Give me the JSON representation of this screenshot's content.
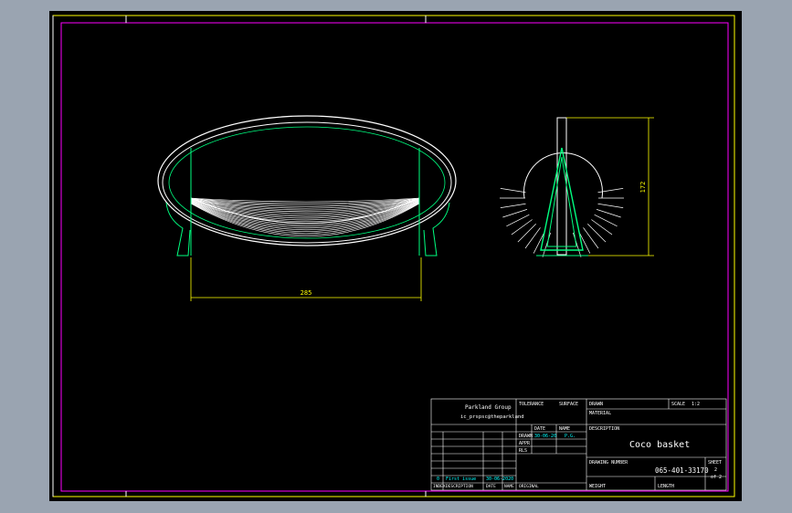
{
  "drawing": {
    "dimensions": {
      "width": "285",
      "height": "172"
    }
  },
  "title_block": {
    "company": "Parkland Group",
    "company_email": "ic_prspsc@theparkland",
    "headers": {
      "tolerance": "TOLERANCE",
      "surface": "SURFACE",
      "drawn": "DRAWN",
      "scale_label": "SCALE",
      "scale_value": "1:2",
      "material": "MATERIAL",
      "description": "DESCRIPTION",
      "drawing_number_label": "DRAWING NUMBER",
      "sheet": "SHEET",
      "sheet_number": "2",
      "sheet_of": "of 2",
      "weight": "WEIGHT",
      "length": "LENGTH"
    },
    "date_col": "DATE",
    "name_col": "NAME",
    "rows": {
      "drawn_label": "DRAWN",
      "drawn_date": "30-06-20",
      "drawn_name": "P.G.",
      "appr_label": "APPR",
      "rls_label": "RLS"
    },
    "title": "Coco basket",
    "drawing_number": "065-401-33170",
    "revision": {
      "index": "0",
      "description": "First issue",
      "date": "30-06-2020"
    },
    "revision_headers": {
      "index": "INDEX",
      "description": "DESCRIPTION",
      "date": "DATE",
      "name": "NAME",
      "original": "ORIGINAL"
    }
  },
  "colors": {
    "background": "#000000",
    "frame": "#ffffff",
    "inner_frame": "#ff00ff",
    "outer_frame": "#ffff00",
    "geometry_white": "#ffffff",
    "geometry_green": "#00ff80",
    "dimension": "#ffff00",
    "text_cyan": "#00ffff"
  }
}
